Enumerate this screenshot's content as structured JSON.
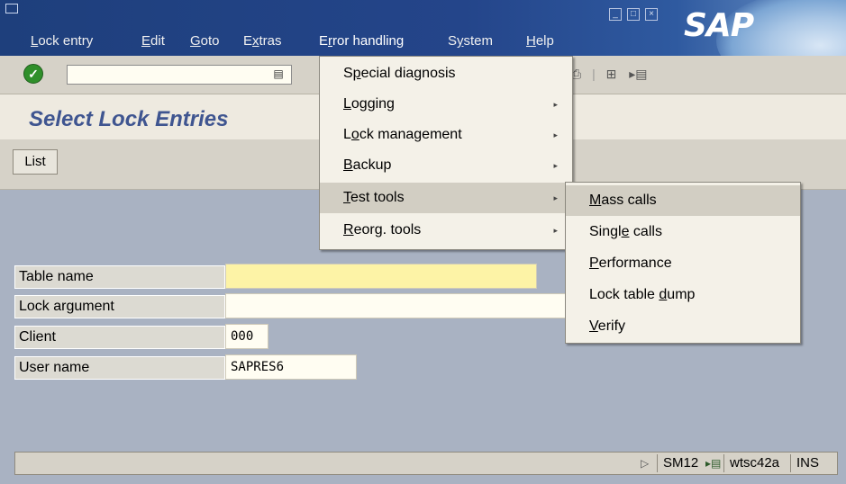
{
  "menubar": {
    "items": [
      "Lock entry",
      "Edit",
      "Goto",
      "Extras",
      "Error handling",
      "System",
      "Help"
    ],
    "active": "Error handling"
  },
  "logo": {
    "text": "SAP"
  },
  "toolbar": {
    "command_value": ""
  },
  "screen": {
    "title": "Select Lock Entries",
    "list_button": "List"
  },
  "form": {
    "fields": [
      {
        "label": "Table name",
        "value": ""
      },
      {
        "label": "Lock argument",
        "value": ""
      },
      {
        "label": "Client",
        "value": "000"
      },
      {
        "label": "User name",
        "value": "SAPRES6"
      }
    ]
  },
  "error_menu": {
    "items": [
      {
        "label": "Special diagnosis",
        "submenu": false
      },
      {
        "label": "Logging",
        "submenu": true
      },
      {
        "label": "Lock management",
        "submenu": true
      },
      {
        "label": "Backup",
        "submenu": true
      },
      {
        "label": "Test tools",
        "submenu": true
      },
      {
        "label": "Reorg. tools",
        "submenu": true
      }
    ],
    "highlighted": "Test tools"
  },
  "test_tools_menu": {
    "items": [
      "Mass calls",
      "Single calls",
      "Performance",
      "Lock table dump",
      "Verify"
    ],
    "highlighted": "Mass calls"
  },
  "statusbar": {
    "transaction": "SM12",
    "server": "wtsc42a",
    "mode": "INS"
  },
  "colors": {
    "title": "#3f5590",
    "body_bg": "#a9b2c2",
    "menubar_bg": "#24458a",
    "input_required": "#fdf3a6"
  }
}
